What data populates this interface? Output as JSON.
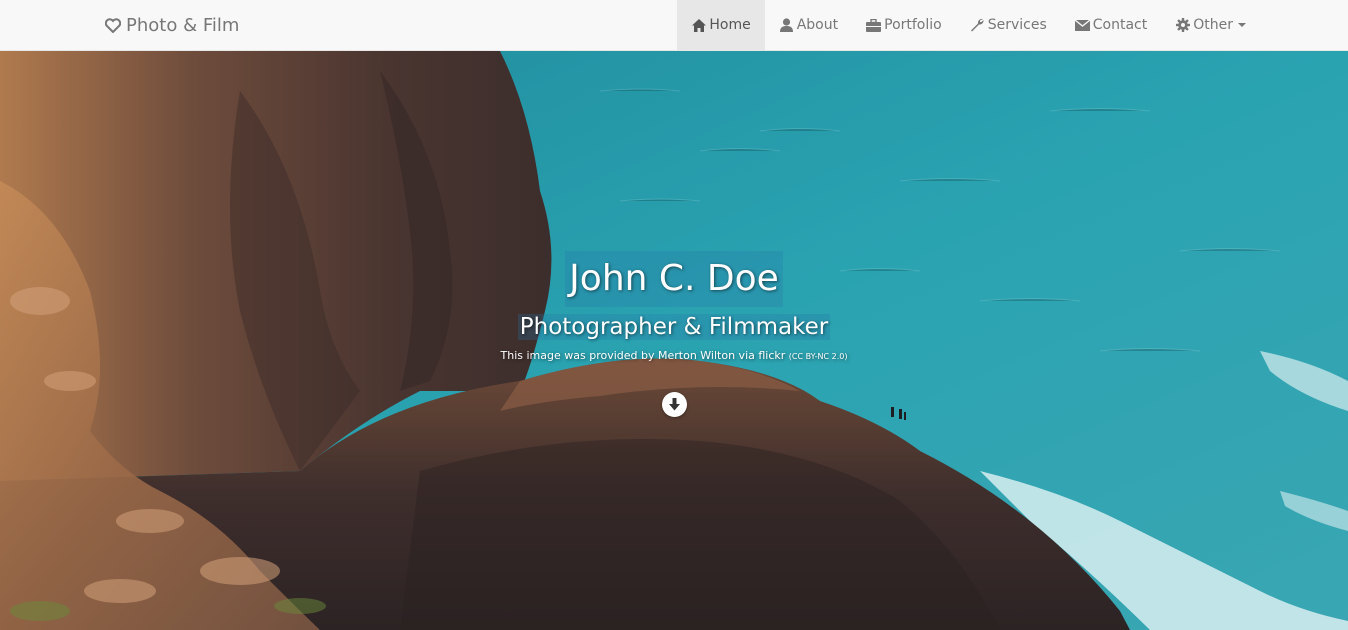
{
  "navbar": {
    "brand": "Photo & Film",
    "brand_icon": "heart-icon",
    "items": [
      {
        "label": "Home",
        "icon": "home-icon",
        "active": true
      },
      {
        "label": "About",
        "icon": "user-icon",
        "active": false
      },
      {
        "label": "Portfolio",
        "icon": "briefcase-icon",
        "active": false
      },
      {
        "label": "Services",
        "icon": "wrench-icon",
        "active": false
      },
      {
        "label": "Contact",
        "icon": "envelope-icon",
        "active": false
      },
      {
        "label": "Other",
        "icon": "gear-icon",
        "active": false,
        "dropdown": true
      }
    ]
  },
  "hero": {
    "title": "John C. Doe",
    "subtitle": "Photographer & Filmmaker",
    "credit": "This image was provided by Merton Wilton via flickr",
    "license": "(CC BY-NC 2.0)",
    "scroll_icon": "arrow-down-icon"
  },
  "colors": {
    "navbar_bg": "#f8f8f8",
    "navbar_text": "#777777",
    "active_bg": "#e7e7e7",
    "sea": "#2a9bab",
    "rock": "#6b4a3a"
  }
}
